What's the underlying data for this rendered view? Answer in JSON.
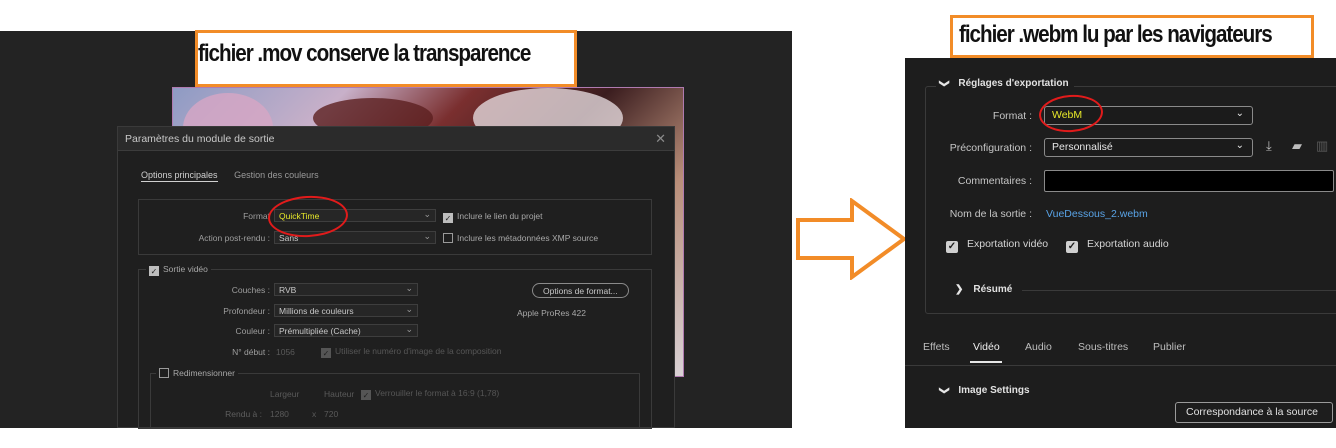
{
  "callouts": {
    "left": "fichier  .mov  conserve la transparence",
    "right": "fichier  .webm lu par les navigateurs"
  },
  "ae_dialog": {
    "title": "Paramètres du module de sortie",
    "close_glyph": "✕",
    "tabs": [
      "Options principales",
      "Gestion des couleurs"
    ],
    "format_label": "Format",
    "format_value": "QuickTime",
    "include_project_link": {
      "label": "Inclure le lien du projet",
      "checked": true
    },
    "post_render_label": "Action post-rendu :",
    "post_render_value": "Sans",
    "include_xmp": {
      "label": "Inclure les métadonnées XMP source",
      "checked": false
    },
    "video_output": {
      "label": "Sortie vidéo",
      "checked": true
    },
    "channels_label": "Couches :",
    "channels_value": "RVB",
    "depth_label": "Profondeur :",
    "depth_value": "Millions de couleurs",
    "color_label": "Couleur :",
    "color_value": "Prémultipliée (Cache)",
    "start_label": "N° début :",
    "start_value": "1056",
    "use_comp_frame": {
      "label": "Utiliser le numéro d'image de la composition",
      "checked": true
    },
    "format_options_button": "Options de format...",
    "codec_info": "Apple ProRes 422",
    "resize": {
      "label": "Redimensionner",
      "checked": false
    },
    "width_label": "Largeur",
    "height_label": "Hauteur",
    "lock_aspect": {
      "label": "Verrouiller le format à 16:9 (1,78)",
      "checked": true
    },
    "rendered_label": "Rendu à :",
    "rendered_w": "1280",
    "times": "x",
    "rendered_h": "720",
    "chevron": "⌄"
  },
  "pr_panel": {
    "export_settings_title": "Réglages d'exportation",
    "format_label": "Format :",
    "format_value": "WebM",
    "preset_label": "Préconfiguration :",
    "preset_value": "Personnalisé",
    "comments_label": "Commentaires :",
    "output_name_label": "Nom de la sortie :",
    "output_name_value": "VueDessous_2.webm",
    "export_video": {
      "label": "Exportation vidéo",
      "checked": true
    },
    "export_audio": {
      "label": "Exportation audio",
      "checked": true
    },
    "summary_label": "Résumé",
    "tabs": [
      "Effets",
      "Vidéo",
      "Audio",
      "Sous-titres",
      "Publier"
    ],
    "active_tab": "Vidéo",
    "image_settings": "Image Settings",
    "match_source_button": "Correspondance à la source",
    "chevron_open": "❯",
    "select_chevron": "⌄",
    "check_glyph": "✓"
  },
  "colors": {
    "callout_border": "#f28c28",
    "highlight_ellipse": "#e11b1b",
    "highlight_text": "#e7e82a",
    "link": "#59a3e6"
  }
}
